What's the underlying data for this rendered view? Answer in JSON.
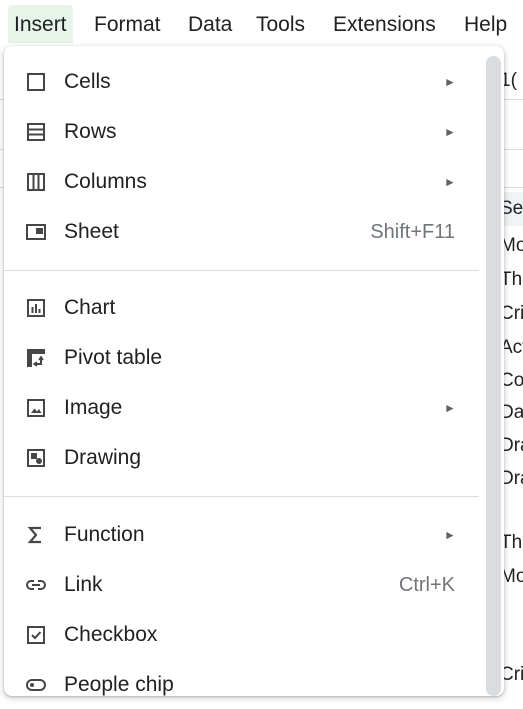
{
  "menubar": {
    "items": [
      {
        "label": "Insert"
      },
      {
        "label": "Format"
      },
      {
        "label": "Data"
      },
      {
        "label": "Tools"
      },
      {
        "label": "Extensions"
      },
      {
        "label": "Help"
      }
    ]
  },
  "insert_menu": {
    "items": [
      {
        "label": "Cells",
        "icon": "cells-icon",
        "submenu_arrow": "►"
      },
      {
        "label": "Rows",
        "icon": "rows-icon",
        "submenu_arrow": "►"
      },
      {
        "label": "Columns",
        "icon": "columns-icon",
        "submenu_arrow": "►"
      },
      {
        "label": "Sheet",
        "icon": "sheet-icon",
        "shortcut": "Shift+F11"
      },
      {
        "label": "Chart",
        "icon": "chart-icon"
      },
      {
        "label": "Pivot table",
        "icon": "pivot-table-icon"
      },
      {
        "label": "Image",
        "icon": "image-icon",
        "submenu_arrow": "►"
      },
      {
        "label": "Drawing",
        "icon": "drawing-icon"
      },
      {
        "label": "Function",
        "icon": "function-icon",
        "submenu_arrow": "►"
      },
      {
        "label": "Link",
        "icon": "link-icon",
        "shortcut": "Ctrl+K"
      },
      {
        "label": "Checkbox",
        "icon": "checkbox-icon"
      },
      {
        "label": "People chip",
        "icon": "people-chip-icon"
      }
    ]
  },
  "background": {
    "right_column": [
      "1(",
      "",
      "Se",
      "Mo",
      "Thr",
      "Cri",
      "Act",
      "Cor",
      "Dar",
      "Dra",
      "Dra",
      "",
      "Thr",
      "Mo",
      "",
      "",
      "Cri"
    ]
  },
  "colors": {
    "active_menu_bg": "#e6f4ea",
    "text": "#202124",
    "muted": "#70757a",
    "divider": "#dadce0"
  }
}
